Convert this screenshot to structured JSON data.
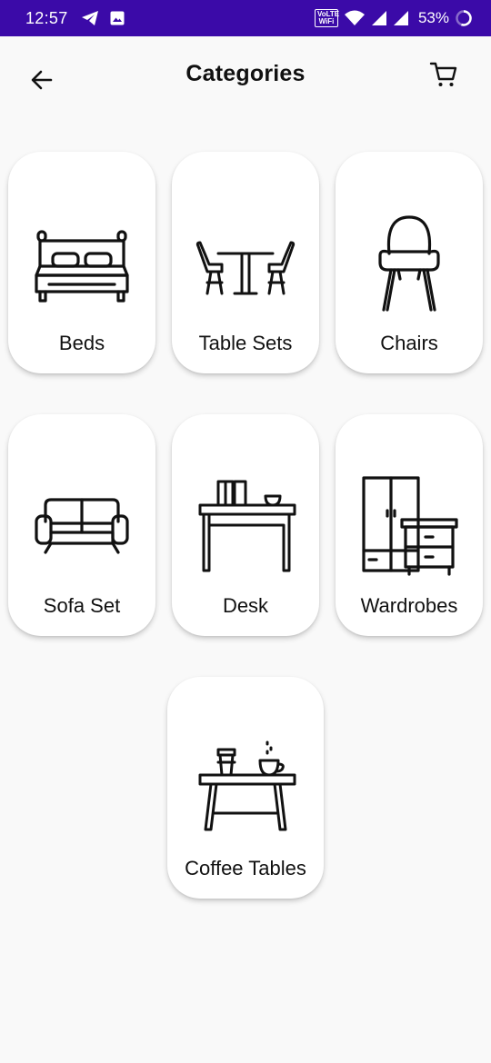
{
  "status_bar": {
    "time": "12:57",
    "battery": "53%",
    "volte_label": "VoLTE WiFi",
    "icons": [
      "telegram-icon",
      "gallery-icon",
      "wifi-icon",
      "signal-icon",
      "battery-icon"
    ]
  },
  "header": {
    "title": "Categories",
    "back_icon": "arrow-left-icon",
    "cart_icon": "cart-icon"
  },
  "categories": [
    {
      "label": "Beds",
      "icon": "bed-icon"
    },
    {
      "label": "Table Sets",
      "icon": "table-set-icon"
    },
    {
      "label": "Chairs",
      "icon": "chair-icon"
    },
    {
      "label": "Sofa Set",
      "icon": "sofa-icon"
    },
    {
      "label": "Desk",
      "icon": "desk-icon"
    },
    {
      "label": "Wardrobes",
      "icon": "wardrobe-icon"
    },
    {
      "label": "Coffee Tables",
      "icon": "coffee-table-icon"
    }
  ],
  "colors": {
    "status_bar": "#3b0aa8",
    "background": "#f9f9f9",
    "card": "#ffffff",
    "text": "#111111"
  }
}
